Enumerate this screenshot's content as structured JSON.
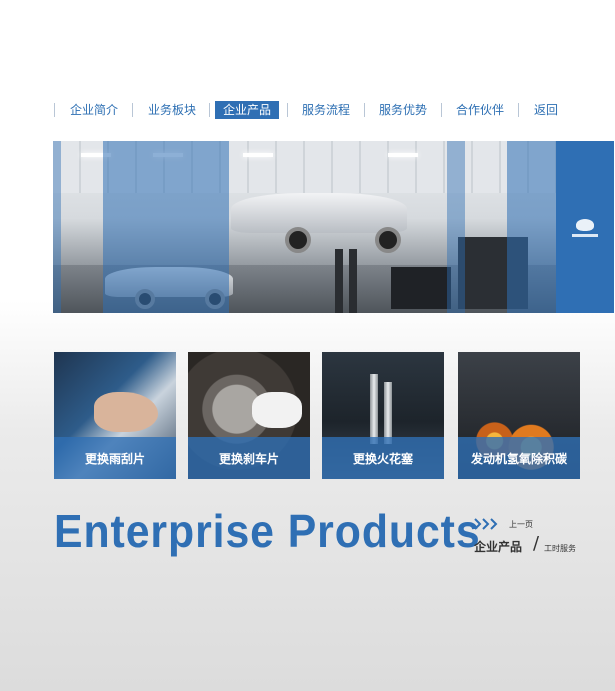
{
  "nav": {
    "items": [
      {
        "label": "企业简介",
        "active": false
      },
      {
        "label": "业务板块",
        "active": false
      },
      {
        "label": "企业产品",
        "active": true
      },
      {
        "label": "服务流程",
        "active": false
      },
      {
        "label": "服务优势",
        "active": false
      },
      {
        "label": "合作伙伴",
        "active": false
      },
      {
        "label": "返回",
        "active": false
      }
    ]
  },
  "banner": {
    "brand_icon": "car-brand-logo-icon"
  },
  "products": [
    {
      "label": "更换雨刮片",
      "icon": "wiper-photo"
    },
    {
      "label": "更换刹车片",
      "icon": "brake-photo"
    },
    {
      "label": "更换火花塞",
      "icon": "spark-plug-photo"
    },
    {
      "label": "发动机氢氧除积碳",
      "icon": "engine-photo"
    }
  ],
  "footer": {
    "title": "Enterprise  Products",
    "prev_link": "上一页",
    "section_name": "企业产品",
    "slash": "/",
    "section_sub": "工时服务"
  },
  "colors": {
    "accent": "#2f6fb4",
    "overlay": "#2f6fb4"
  }
}
